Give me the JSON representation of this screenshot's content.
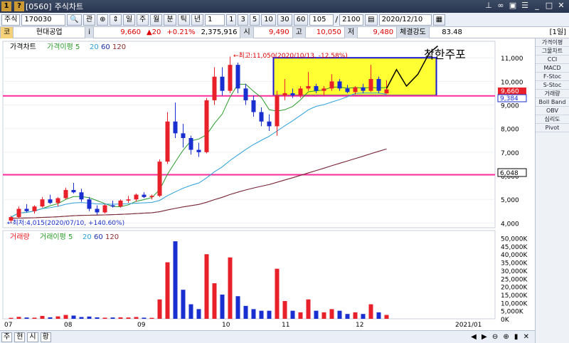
{
  "window": {
    "code": "[0560]",
    "title": "주식차트"
  },
  "toolbar": {
    "market": "주식",
    "code": "170030",
    "kwan": "관",
    "periods": [
      "일",
      "주",
      "월",
      "분",
      "틱",
      "년"
    ],
    "selected_period": "일",
    "count_default": "1",
    "minutes": [
      "1",
      "3",
      "5",
      "10",
      "30",
      "60"
    ],
    "zoom": "105",
    "total": "2100",
    "date": "2020/12/10"
  },
  "info": {
    "badge": "코",
    "name": "현대공업",
    "price": "9,660",
    "change": "▲20",
    "pct": "+0.21%",
    "volume": "2,375,916",
    "open_label": "시",
    "open": "9,490",
    "high_label": "고",
    "high": "10,050",
    "low_label": "저",
    "low": "9,480",
    "strength_label": "체결강도",
    "strength": "83.48",
    "period_tag": "[1일]"
  },
  "price_panel": {
    "legend": [
      "가격차트",
      "가격이평 5",
      "20",
      "60",
      "120"
    ],
    "max_note": "←최고:11,050(2020/10/13, -12.58%)",
    "min_note": "←최저:4,015(2020/07/10, +140.60%)",
    "annotation": "착한주포",
    "price_tag": "9,660",
    "ma_tag": "9,384",
    "line_tag": "6,048",
    "y_ticks": [
      "11,000",
      "10,000",
      "9,000",
      "8,000",
      "7,000",
      "6,000",
      "5,000",
      "4,000"
    ]
  },
  "volume_panel": {
    "legend": [
      "거래량",
      "거래이평 5",
      "20",
      "60",
      "120"
    ],
    "y_ticks": [
      "50,000K",
      "45,000K",
      "40,000K",
      "35,000K",
      "30,000K",
      "25,000K",
      "20,000K",
      "15,000K",
      "10,000K",
      "5,000K",
      "0K"
    ]
  },
  "x_axis": {
    "labels": [
      "07",
      "08",
      "09",
      "10",
      "11",
      "12",
      "2021/01"
    ]
  },
  "right_panel": [
    "가격이평",
    "그물차트",
    "CCI",
    "MACD",
    "F-Stoc",
    "S-Stoc",
    "거래량",
    "Boll Band",
    "OBV",
    "심리도",
    "Pivot"
  ],
  "bottom_tabs": [
    "주",
    "현",
    "시",
    "황"
  ],
  "colors": {
    "up": "#e8202a",
    "down": "#1a2fd0",
    "magenta": "#ff2d9a",
    "yellow": "#ffff33",
    "box": "#1a1acc",
    "ma5": "#2b9a2b",
    "ma20": "#2aa0d8",
    "ma60": "#1a2fa8",
    "ma120": "#8a2a2a"
  },
  "chart_data": {
    "type": "candlestick",
    "price_range": [
      3800,
      11700
    ],
    "volume_range": [
      0,
      52000
    ],
    "candles": [
      {
        "o": 4100,
        "h": 4300,
        "l": 4015,
        "c": 4250
      },
      {
        "o": 4250,
        "h": 4700,
        "l": 4200,
        "c": 4600
      },
      {
        "o": 4600,
        "h": 4800,
        "l": 4450,
        "c": 4500
      },
      {
        "o": 4500,
        "h": 4750,
        "l": 4400,
        "c": 4700
      },
      {
        "o": 4700,
        "h": 5100,
        "l": 4650,
        "c": 5000
      },
      {
        "o": 5000,
        "h": 5200,
        "l": 4800,
        "c": 4850
      },
      {
        "o": 4850,
        "h": 5100,
        "l": 4700,
        "c": 5050
      },
      {
        "o": 5050,
        "h": 5500,
        "l": 5000,
        "c": 5400
      },
      {
        "o": 5400,
        "h": 5700,
        "l": 5250,
        "c": 5300
      },
      {
        "o": 5300,
        "h": 5450,
        "l": 4900,
        "c": 5000
      },
      {
        "o": 5000,
        "h": 5100,
        "l": 4500,
        "c": 4600
      },
      {
        "o": 4600,
        "h": 4750,
        "l": 4350,
        "c": 4450
      },
      {
        "o": 4450,
        "h": 4800,
        "l": 4400,
        "c": 4750
      },
      {
        "o": 4750,
        "h": 4950,
        "l": 4650,
        "c": 4700
      },
      {
        "o": 4700,
        "h": 5000,
        "l": 4650,
        "c": 4950
      },
      {
        "o": 4950,
        "h": 5150,
        "l": 4850,
        "c": 5000
      },
      {
        "o": 5000,
        "h": 5250,
        "l": 4900,
        "c": 5200
      },
      {
        "o": 5200,
        "h": 5300,
        "l": 5050,
        "c": 5100
      },
      {
        "o": 5100,
        "h": 5200,
        "l": 5000,
        "c": 5150
      },
      {
        "o": 5150,
        "h": 6700,
        "l": 5100,
        "c": 6600
      },
      {
        "o": 6600,
        "h": 8700,
        "l": 6500,
        "c": 8300
      },
      {
        "o": 8300,
        "h": 9100,
        "l": 7600,
        "c": 7800
      },
      {
        "o": 7800,
        "h": 8200,
        "l": 7200,
        "c": 7600
      },
      {
        "o": 7600,
        "h": 7700,
        "l": 6900,
        "c": 7100
      },
      {
        "o": 7100,
        "h": 7400,
        "l": 6800,
        "c": 7000
      },
      {
        "o": 7000,
        "h": 9300,
        "l": 6950,
        "c": 9200
      },
      {
        "o": 9200,
        "h": 10600,
        "l": 9000,
        "c": 10200
      },
      {
        "o": 10200,
        "h": 10600,
        "l": 9400,
        "c": 9600
      },
      {
        "o": 9600,
        "h": 11050,
        "l": 9500,
        "c": 10700
      },
      {
        "o": 10700,
        "h": 10800,
        "l": 9500,
        "c": 9700
      },
      {
        "o": 9700,
        "h": 9900,
        "l": 9000,
        "c": 9200
      },
      {
        "o": 9200,
        "h": 9400,
        "l": 8500,
        "c": 8700
      },
      {
        "o": 8700,
        "h": 8900,
        "l": 8100,
        "c": 8300
      },
      {
        "o": 8300,
        "h": 8600,
        "l": 7900,
        "c": 8100
      },
      {
        "o": 8100,
        "h": 9600,
        "l": 7700,
        "c": 9400
      },
      {
        "o": 9400,
        "h": 10100,
        "l": 9200,
        "c": 9500
      },
      {
        "o": 9500,
        "h": 9700,
        "l": 9300,
        "c": 9400
      },
      {
        "o": 9400,
        "h": 9800,
        "l": 9300,
        "c": 9700
      },
      {
        "o": 9700,
        "h": 10400,
        "l": 9600,
        "c": 9800
      },
      {
        "o": 9800,
        "h": 9900,
        "l": 9500,
        "c": 9600
      },
      {
        "o": 9600,
        "h": 9800,
        "l": 9400,
        "c": 9700
      },
      {
        "o": 9700,
        "h": 10300,
        "l": 9600,
        "c": 10000
      },
      {
        "o": 10000,
        "h": 10100,
        "l": 9600,
        "c": 9700
      },
      {
        "o": 9700,
        "h": 9850,
        "l": 9500,
        "c": 9550
      },
      {
        "o": 9550,
        "h": 9800,
        "l": 9450,
        "c": 9750
      },
      {
        "o": 9750,
        "h": 9900,
        "l": 9500,
        "c": 9600
      },
      {
        "o": 9600,
        "h": 10700,
        "l": 9550,
        "c": 10100
      },
      {
        "o": 10100,
        "h": 10200,
        "l": 9500,
        "c": 9600
      },
      {
        "o": 9490,
        "h": 10050,
        "l": 9480,
        "c": 9660
      }
    ],
    "volumes": [
      600,
      1200,
      800,
      700,
      1800,
      900,
      1500,
      2400,
      2000,
      1100,
      1400,
      900,
      700,
      800,
      900,
      800,
      1100,
      700,
      600,
      12000,
      35000,
      48000,
      18000,
      9000,
      6000,
      40000,
      22000,
      15000,
      38000,
      14000,
      8000,
      6000,
      5000,
      5000,
      31000,
      11000,
      5000,
      4000,
      12000,
      5000,
      4000,
      6000,
      5000,
      3000,
      4000,
      3000,
      9000,
      4000,
      2400
    ]
  }
}
